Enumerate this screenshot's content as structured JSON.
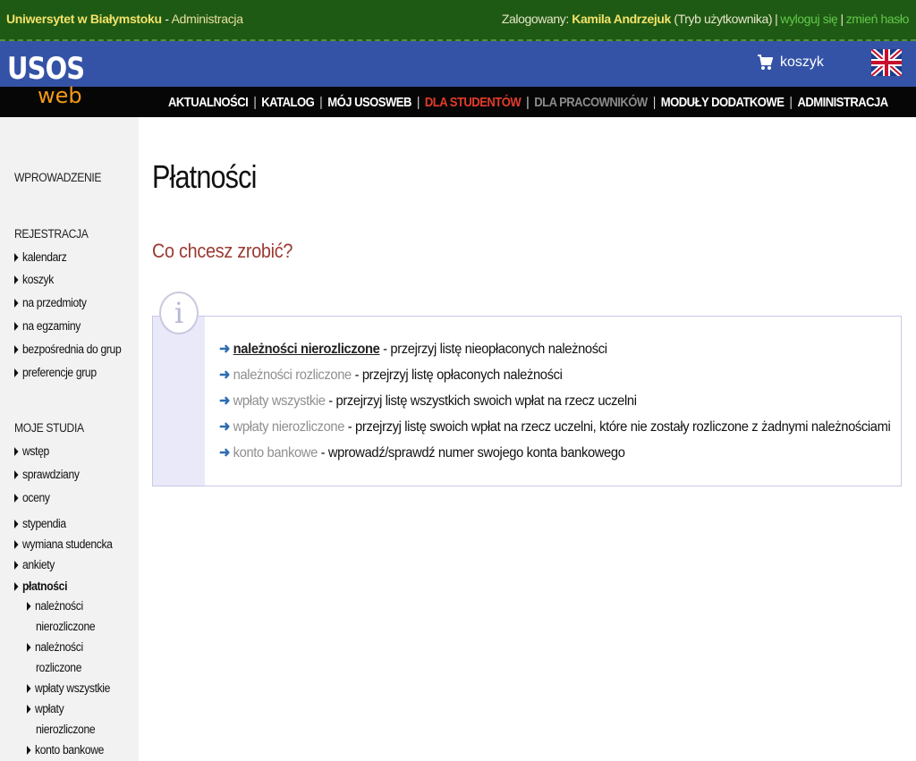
{
  "topbar": {
    "university": "Uniwersytet w Białymstoku",
    "section_sep": " - ",
    "section": "Administracja",
    "logged_label": "Zalogowany: ",
    "user": "Kamila Andrzejuk",
    "mode": " (Tryb użytkownika)",
    "logout": "wyloguj się",
    "change_password": "zmień hasło"
  },
  "logo": {
    "usos": "USOS",
    "web": "web"
  },
  "cart": {
    "label": "koszyk"
  },
  "nav": {
    "items": [
      {
        "label": "AKTUALNOŚCI"
      },
      {
        "label": "KATALOG"
      },
      {
        "label": "MÓJ USOSWEB"
      },
      {
        "label": "DLA STUDENTÓW"
      },
      {
        "label": "DLA PRACOWNIKÓW"
      },
      {
        "label": "MODUŁY DODATKOWE"
      },
      {
        "label": "ADMINISTRACJA"
      }
    ]
  },
  "sidebar": {
    "intro": "WPROWADZENIE",
    "registration_head": "REJESTRACJA",
    "registration": [
      "kalendarz",
      "koszyk",
      "na przedmioty",
      "na egzaminy",
      "bezpośrednia do grup",
      "preferencje grup"
    ],
    "studies_head": "MOJE STUDIA",
    "studies": [
      "wstęp",
      "sprawdziany",
      "oceny",
      "stypendia",
      "wymiana studencka",
      "ankiety",
      "płatności"
    ],
    "payments_sub": [
      "należności",
      "nierozliczone",
      "należności",
      "rozliczone",
      "wpłaty wszystkie",
      "wpłaty",
      "nierozliczone",
      "konto bankowe"
    ]
  },
  "main": {
    "title": "Płatności",
    "question": "Co chcesz zrobić?",
    "info_glyph": "i",
    "arrow": "➜",
    "options": [
      {
        "link": "należności nierozliczone",
        "desc": " - przejrzyj listę nieopłaconych należności"
      },
      {
        "link": "należności rozliczone",
        "desc": " - przejrzyj listę opłaconych należności"
      },
      {
        "link": "wpłaty wszystkie",
        "desc": " - przejrzyj listę wszystkich swoich wpłat na rzecz uczelni"
      },
      {
        "link": "wpłaty nierozliczone",
        "desc": " - przejrzyj listę swoich wpłat na rzecz uczelni, które nie zostały rozliczone z żadnymi należnościami"
      },
      {
        "link": "konto bankowe",
        "desc": " - wprowadź/sprawdź numer swojego konta bankowego"
      }
    ]
  },
  "colors": {
    "top_bg": "#1f5a14",
    "blue_bar": "#3553a6",
    "nav_bg": "#060606",
    "active_nav": "#e43b2a",
    "question": "#9a3a32",
    "arrow": "#2e6cb0"
  }
}
